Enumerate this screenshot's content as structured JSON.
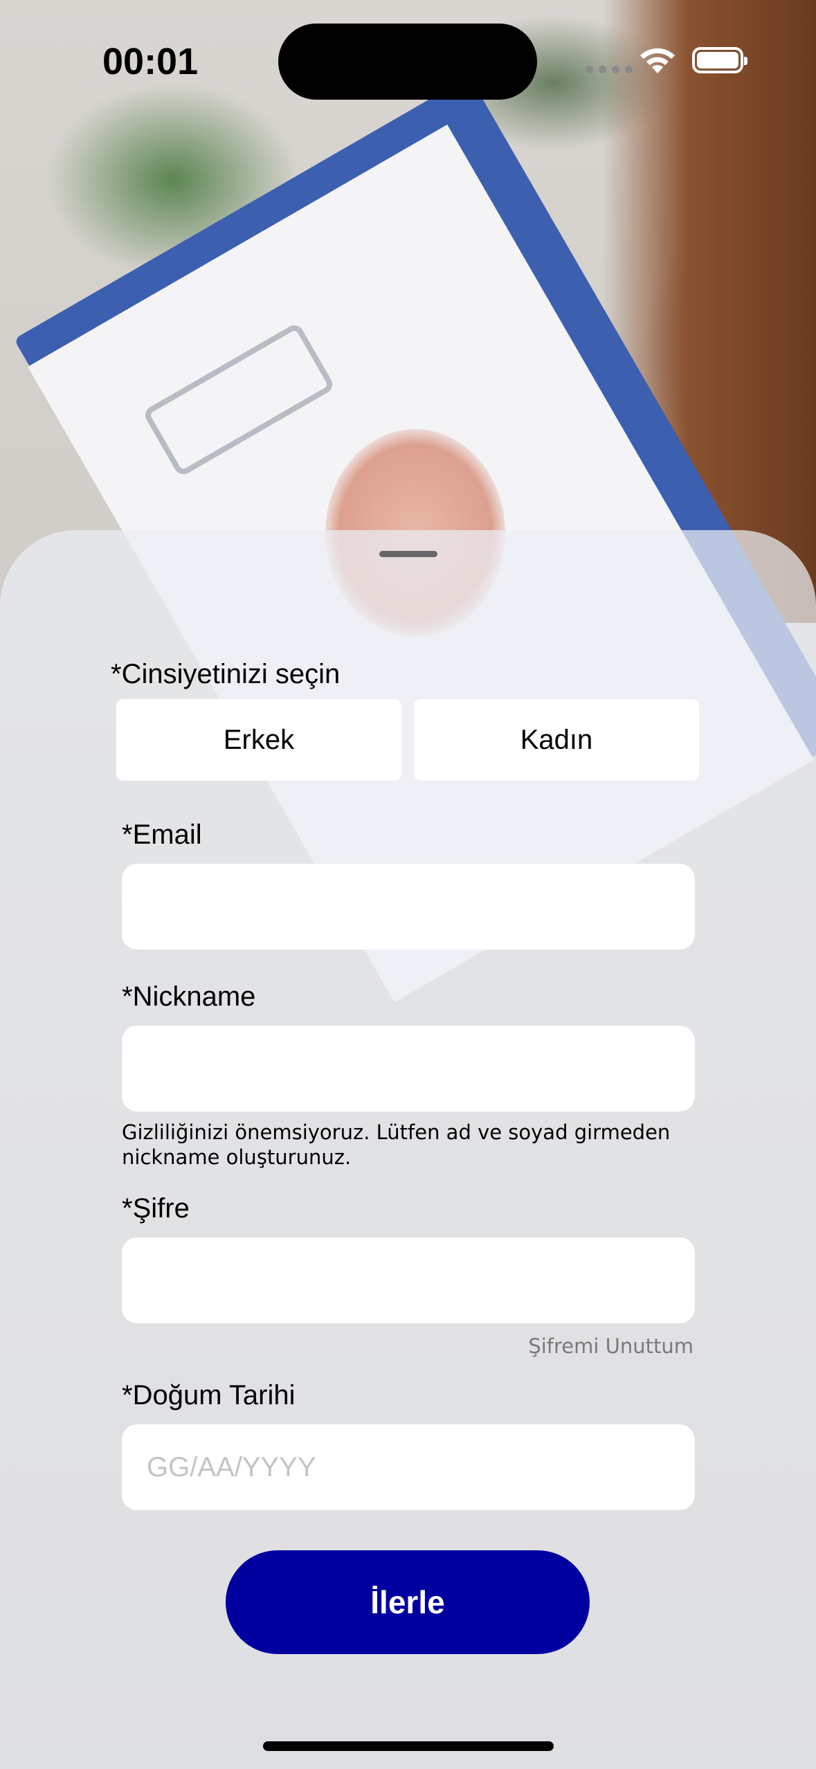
{
  "status_bar": {
    "time": "00:01"
  },
  "icons": {
    "wifi": "wifi-icon",
    "battery": "battery-icon",
    "signal": "cellular-signal-icon"
  },
  "form": {
    "gender_label": "*Cinsiyetinizi seçin",
    "gender_options": [
      "Erkek",
      "Kadın"
    ],
    "email_label": "*Email",
    "email_value": "",
    "nickname_label": "*Nickname",
    "nickname_value": "",
    "privacy_hint": "Gizliliğinizi önemsiyoruz. Lütfen ad ve soyad girmeden nickname oluşturunuz.",
    "password_label": "*Şifre",
    "password_value": "",
    "forgot_password": "Şifremi Unuttum",
    "birthdate_label": "*Doğum Tarihi",
    "birthdate_placeholder": "GG/AA/YYYY",
    "submit_label": "İlerle"
  },
  "colors": {
    "primary_button": "#0000a0",
    "sheet_background": "#eceef4"
  }
}
